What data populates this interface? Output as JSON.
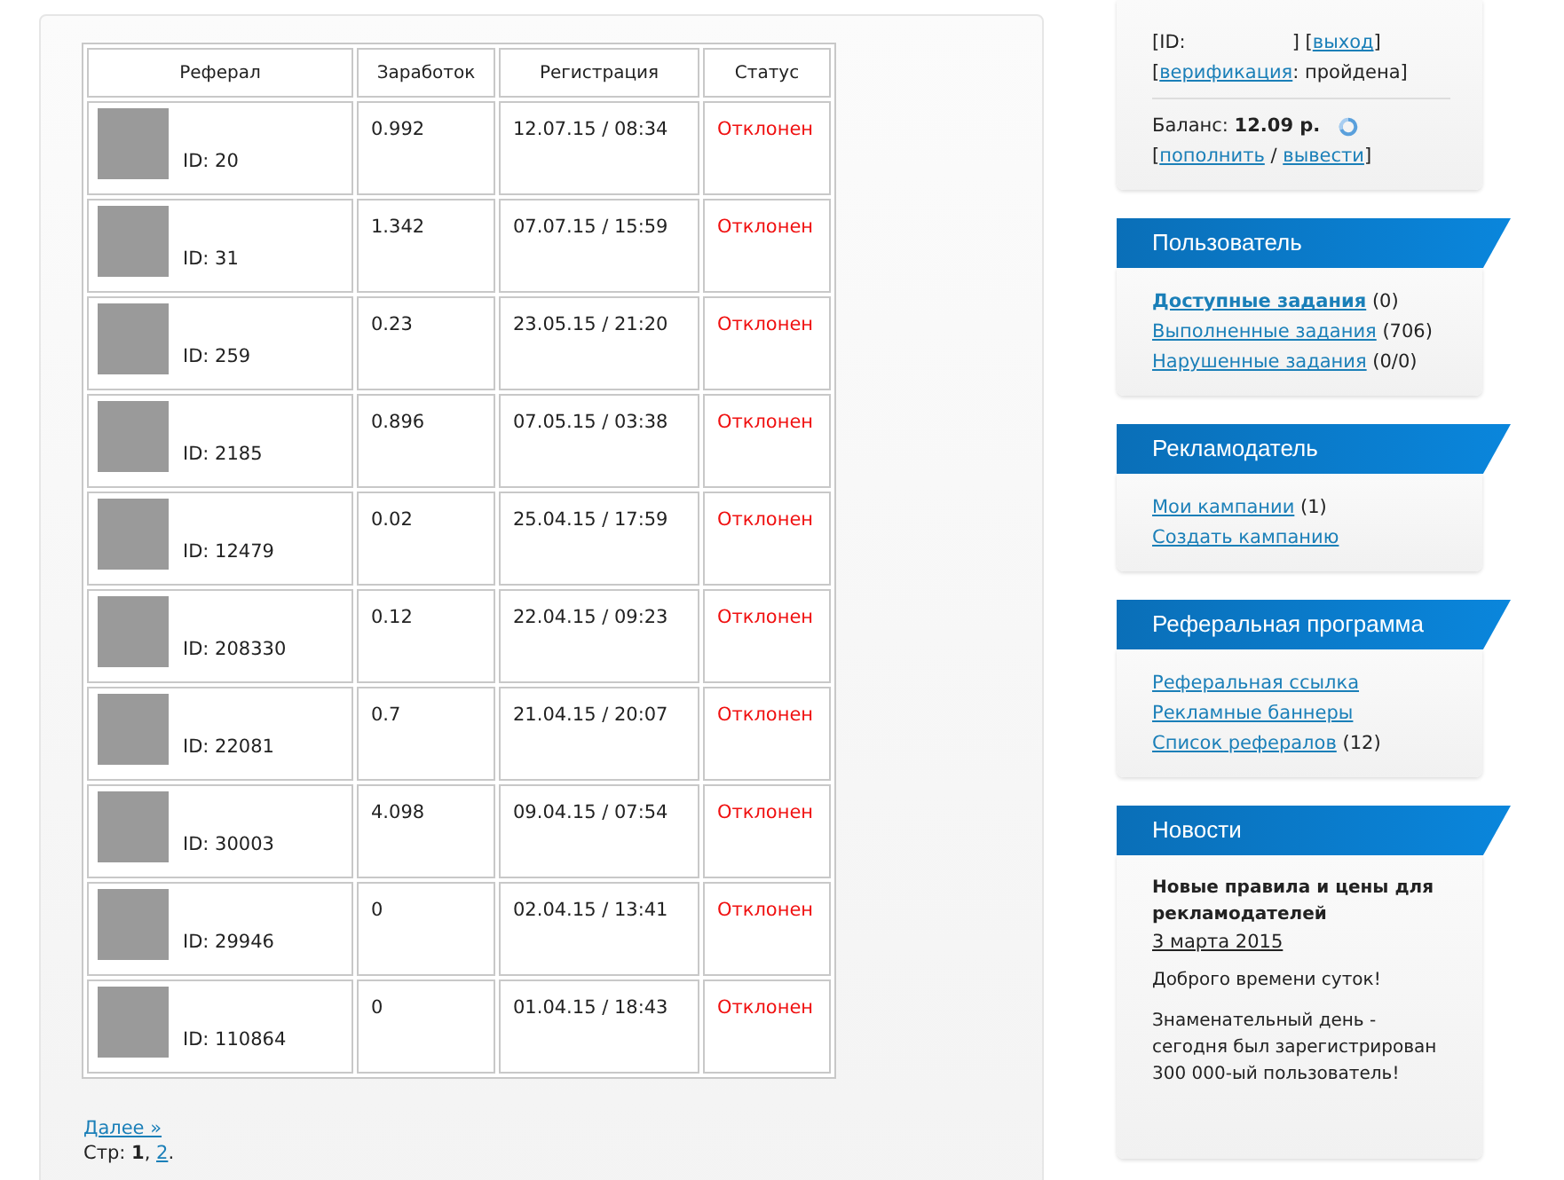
{
  "referrals": {
    "columns": [
      "Реферал",
      "Заработок",
      "Регистрация",
      "Статус"
    ],
    "rows": [
      {
        "id": "ID: 20",
        "earned": "0.992",
        "registered": "12.07.15 / 08:34",
        "status": "Отклонен"
      },
      {
        "id": "ID: 31",
        "earned": "1.342",
        "registered": "07.07.15 / 15:59",
        "status": "Отклонен"
      },
      {
        "id": "ID: 259",
        "earned": "0.23",
        "registered": "23.05.15 / 21:20",
        "status": "Отклонен"
      },
      {
        "id": "ID: 2185",
        "earned": "0.896",
        "registered": "07.05.15 / 03:38",
        "status": "Отклонен"
      },
      {
        "id": "ID: 12479",
        "earned": "0.02",
        "registered": "25.04.15 / 17:59",
        "status": "Отклонен"
      },
      {
        "id": "ID: 208330",
        "earned": "0.12",
        "registered": "22.04.15 / 09:23",
        "status": "Отклонен"
      },
      {
        "id": "ID: 22081",
        "earned": "0.7",
        "registered": "21.04.15 / 20:07",
        "status": "Отклонен"
      },
      {
        "id": "ID: 30003",
        "earned": "4.098",
        "registered": "09.04.15 / 07:54",
        "status": "Отклонен"
      },
      {
        "id": "ID: 29946",
        "earned": "0",
        "registered": "02.04.15 / 13:41",
        "status": "Отклонен"
      },
      {
        "id": "ID: 110864",
        "earned": "0",
        "registered": "01.04.15 / 18:43",
        "status": "Отклонен"
      }
    ],
    "next_link": "Далее »",
    "pagination": {
      "label": "Стр:",
      "pages": [
        {
          "text": "1",
          "selected": true,
          "suffix": ","
        },
        {
          "text": "2",
          "selected": false,
          "suffix": "."
        }
      ]
    }
  },
  "account": {
    "lines": [
      [
        {
          "kind": "text",
          "text": "[ID:"
        },
        {
          "kind": "gap"
        },
        {
          "kind": "text",
          "text": "]"
        },
        {
          "kind": "text",
          "text": " ["
        },
        {
          "kind": "link",
          "text": "выход"
        },
        {
          "kind": "text",
          "text": "]"
        }
      ],
      [
        {
          "kind": "text",
          "text": "["
        },
        {
          "kind": "link",
          "text": "верификация"
        },
        {
          "kind": "text",
          "text": ": пройдена]"
        }
      ]
    ],
    "balance": "Баланс: **12.09 р.**",
    "actions": [
      {
        "kind": "text",
        "text": "["
      },
      {
        "kind": "link",
        "text": "пополнить"
      },
      {
        "kind": "text",
        "text": " / "
      },
      {
        "kind": "link",
        "text": "вывести"
      },
      {
        "kind": "text",
        "text": "]"
      }
    ]
  },
  "sidebar": [
    {
      "title": "Пользователь",
      "items": [
        {
          "link": "Доступные задания",
          "count": "(0)",
          "selected": true
        },
        {
          "link": "Выполненные задания",
          "count": "(706)",
          "selected": false
        },
        {
          "link": "Нарушенные задания",
          "count": "(0/0)",
          "selected": false
        }
      ]
    },
    {
      "title": "Рекламодатель",
      "items": [
        {
          "link": "Мои кампании",
          "count": "(1)",
          "selected": false
        },
        {
          "link": "Создать кампанию",
          "selected": false
        }
      ]
    },
    {
      "title": "Реферальная программа",
      "items": [
        {
          "link": "Реферальная ссылка",
          "selected": false
        },
        {
          "link": "Рекламные баннеры",
          "selected": false
        },
        {
          "link": "Список рефералов",
          "count": "(12)",
          "selected": false
        }
      ]
    }
  ],
  "news": {
    "title": "Новости",
    "headline": "Новые правила и цены для рекламодателей",
    "date": "3 марта 2015",
    "paragraphs": [
      "Доброго времени суток!",
      "Знаменательный день - сегодня был зарегистрирован 300 000-ый пользователь!"
    ]
  }
}
